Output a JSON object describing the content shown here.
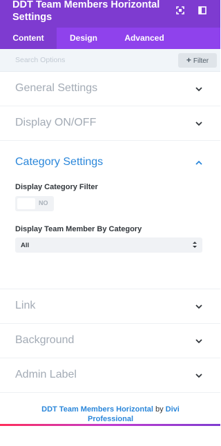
{
  "header": {
    "title": "DDT Team Members Horizontal Settings"
  },
  "tabs": [
    {
      "label": "Content",
      "active": true
    },
    {
      "label": "Design",
      "active": false
    },
    {
      "label": "Advanced",
      "active": false
    }
  ],
  "search": {
    "placeholder": "Search Options",
    "filter_label": "Filter"
  },
  "sections": {
    "general": "General Settings",
    "display": "Display ON/OFF",
    "category": "Category Settings",
    "link": "Link",
    "background": "Background",
    "admin": "Admin Label"
  },
  "category": {
    "filter_label": "Display Category Filter",
    "toggle_state": "NO",
    "by_category_label": "Display Team Member By Category",
    "select_value": "All"
  },
  "footer": {
    "module_link": "DDT Team Members Horizontal",
    "by": "by",
    "author_link": "Divi Professional"
  },
  "colors": {
    "header_bg": "#7e3bd0",
    "tabs_bg": "#8f42ec",
    "accent": "#2b87da"
  }
}
